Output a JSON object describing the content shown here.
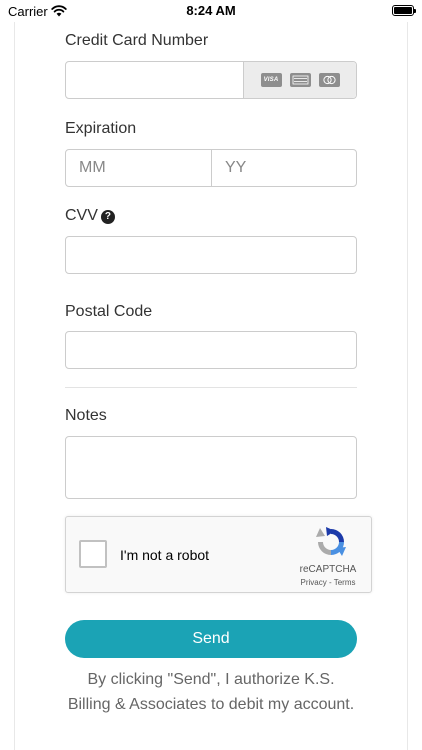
{
  "status_bar": {
    "carrier": "Carrier",
    "time": "8:24 AM",
    "wifi_icon": "wifi-icon",
    "battery_icon": "battery-icon"
  },
  "form": {
    "card_number": {
      "label": "Credit Card Number",
      "value": "",
      "brands": [
        "VISA",
        "AMEX",
        "MASTERCARD"
      ]
    },
    "expiration": {
      "label": "Expiration",
      "month_placeholder": "MM",
      "year_placeholder": "YY"
    },
    "cvv": {
      "label": "CVV",
      "help_icon": "question-circle-icon",
      "help_glyph": "?"
    },
    "postal_code": {
      "label": "Postal Code",
      "value": ""
    },
    "notes": {
      "label": "Notes",
      "value": ""
    }
  },
  "captcha": {
    "checkbox_label": "I'm not a robot",
    "brand": "reCAPTCHA",
    "links": "Privacy - Terms"
  },
  "send_button": {
    "label": "Send",
    "color": "#1ba3b5"
  },
  "disclaimer": "By clicking \"Send\", I authorize K.S. Billing & Associates to debit my account."
}
